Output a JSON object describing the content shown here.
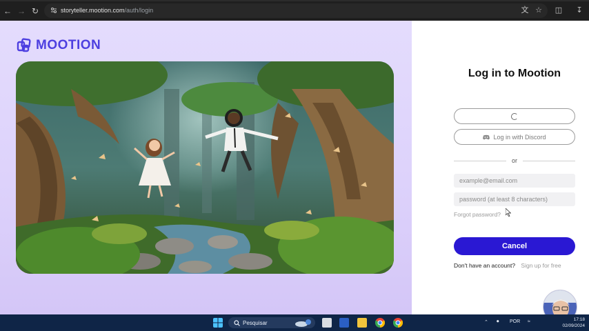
{
  "browser": {
    "url_host": "storyteller.mootion.com",
    "url_path": "/auth/login",
    "icons": [
      "back-arrow-icon",
      "forward-arrow-icon",
      "reload-icon",
      "site-settings-icon",
      "translate-icon",
      "star-icon",
      "extensions-icon",
      "download-icon"
    ]
  },
  "brand": {
    "name": "MOOTION",
    "accent": "#4d3fe0"
  },
  "login": {
    "title": "Log in to Mootion",
    "discord_label": "Log in with Discord",
    "or_label": "or",
    "email_placeholder": "example@email.com",
    "password_placeholder": "password (at least 8 characters)",
    "forgot_label": "Forgot password?",
    "cancel_label": "Cancel",
    "signup_question": "Don't have an account?",
    "signup_link": "Sign up for free",
    "primary_color": "#2a18d3"
  },
  "taskbar": {
    "search_label": "Pesquisar",
    "language": "POR",
    "time": "17:18",
    "date": "02/09/2024"
  }
}
